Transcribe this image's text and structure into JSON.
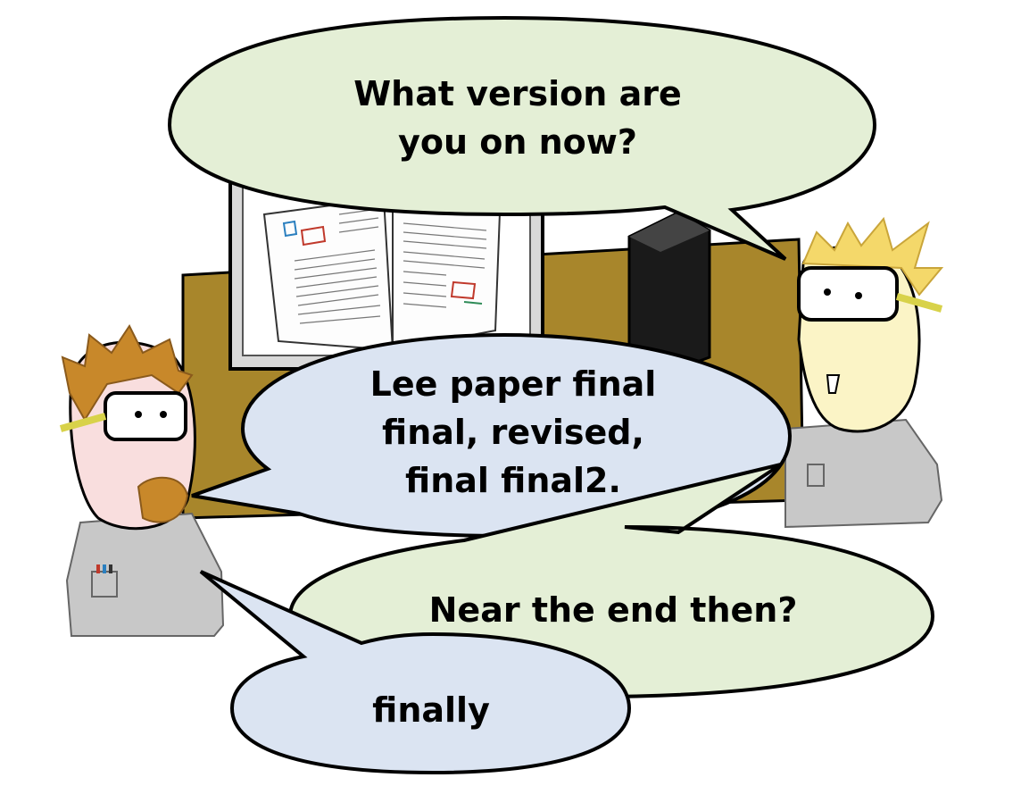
{
  "bubbles": {
    "top_right": {
      "lines": [
        "What version are",
        "you on now?"
      ],
      "fill": "#e4efd6"
    },
    "middle_left": {
      "lines": [
        "Lee paper final",
        "final, revised,",
        "final final2."
      ],
      "fill": "#dbe4f2"
    },
    "lower_right": {
      "lines": [
        "Near the end then?"
      ],
      "fill": "#e4efd6"
    },
    "bottom_left": {
      "lines": [
        "finally"
      ],
      "fill": "#dbe4f2"
    }
  },
  "colors": {
    "outline": "#000000",
    "desk": "#a8862b",
    "monitor_frame": "#d8d8d8",
    "shirt": "#c8c8c8",
    "goggle_strap": "#d8d24a"
  },
  "figures": {
    "left_person": "bearded-scientist-with-goggles",
    "right_person": "blond-scientist-with-goggles"
  }
}
